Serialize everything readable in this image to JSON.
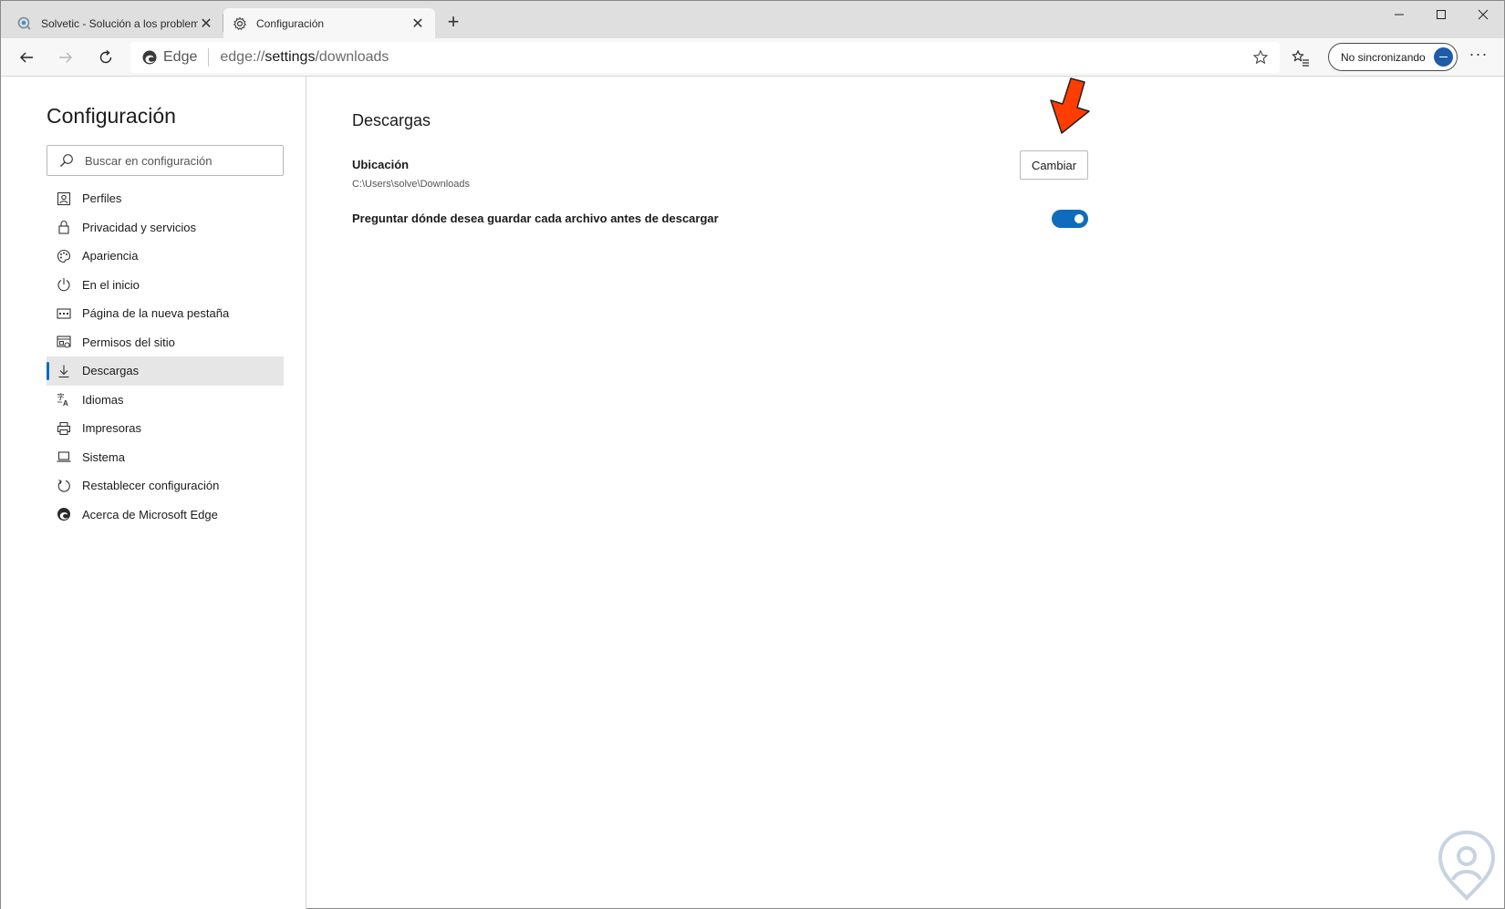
{
  "tabs": [
    {
      "title": "Solvetic - Solución a los problem",
      "active": false,
      "icon": "solvetic-favicon"
    },
    {
      "title": "Configuración",
      "active": true,
      "icon": "gear-icon"
    }
  ],
  "toolbar": {
    "address_prefix": "Edge",
    "url_scheme": "edge://",
    "url_host": "settings",
    "url_path": "/downloads",
    "sync_label": "No sincronizando"
  },
  "sidebar": {
    "title": "Configuración",
    "search_placeholder": "Buscar en configuración",
    "items": [
      {
        "label": "Perfiles",
        "icon": "profile-icon"
      },
      {
        "label": "Privacidad y servicios",
        "icon": "lock-icon"
      },
      {
        "label": "Apariencia",
        "icon": "palette-icon"
      },
      {
        "label": "En el inicio",
        "icon": "power-icon"
      },
      {
        "label": "Página de la nueva pestaña",
        "icon": "new-tab-page-icon"
      },
      {
        "label": "Permisos del sitio",
        "icon": "site-permissions-icon"
      },
      {
        "label": "Descargas",
        "icon": "download-icon",
        "selected": true
      },
      {
        "label": "Idiomas",
        "icon": "languages-icon"
      },
      {
        "label": "Impresoras",
        "icon": "printer-icon"
      },
      {
        "label": "Sistema",
        "icon": "laptop-icon"
      },
      {
        "label": "Restablecer configuración",
        "icon": "reset-icon"
      },
      {
        "label": "Acerca de Microsoft Edge",
        "icon": "edge-logo-icon"
      }
    ]
  },
  "main": {
    "title": "Descargas",
    "location_label": "Ubicación",
    "location_path": "C:\\Users\\solve\\Downloads",
    "change_button": "Cambiar",
    "ask_label": "Preguntar dónde desea guardar cada archivo antes de descargar",
    "ask_enabled": true
  },
  "colors": {
    "accent": "#0f6cbd",
    "arrow": "#ff3d00",
    "tabstrip": "#dfdfdf",
    "toolbar": "#f7f7f7"
  }
}
